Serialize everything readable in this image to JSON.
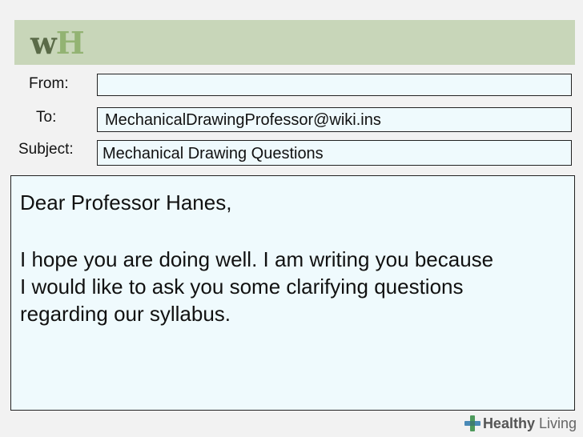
{
  "header": {
    "logo_w": "w",
    "logo_h": "H"
  },
  "from": {
    "label": "From:",
    "value": ""
  },
  "to": {
    "label": "To:",
    "value": "MechanicalDrawingProfessor@wiki.ins"
  },
  "subject": {
    "label": "Subject:",
    "value": "Mechanical Drawing Questions"
  },
  "message": {
    "greeting": "Dear Professor Hanes,",
    "lines": [
      "I hope you are doing well. I am writing you because",
      "I would like to ask you some clarifying questions",
      "regarding our syllabus."
    ]
  },
  "watermark": {
    "bold": "Healthy",
    "rest": " Living",
    "icon": "cross-icon"
  },
  "colors": {
    "banner": "#c8d6b9",
    "field_bg": "#effafd",
    "cross_green": "#4e9a5c",
    "cross_blue": "#4a8ab7"
  }
}
